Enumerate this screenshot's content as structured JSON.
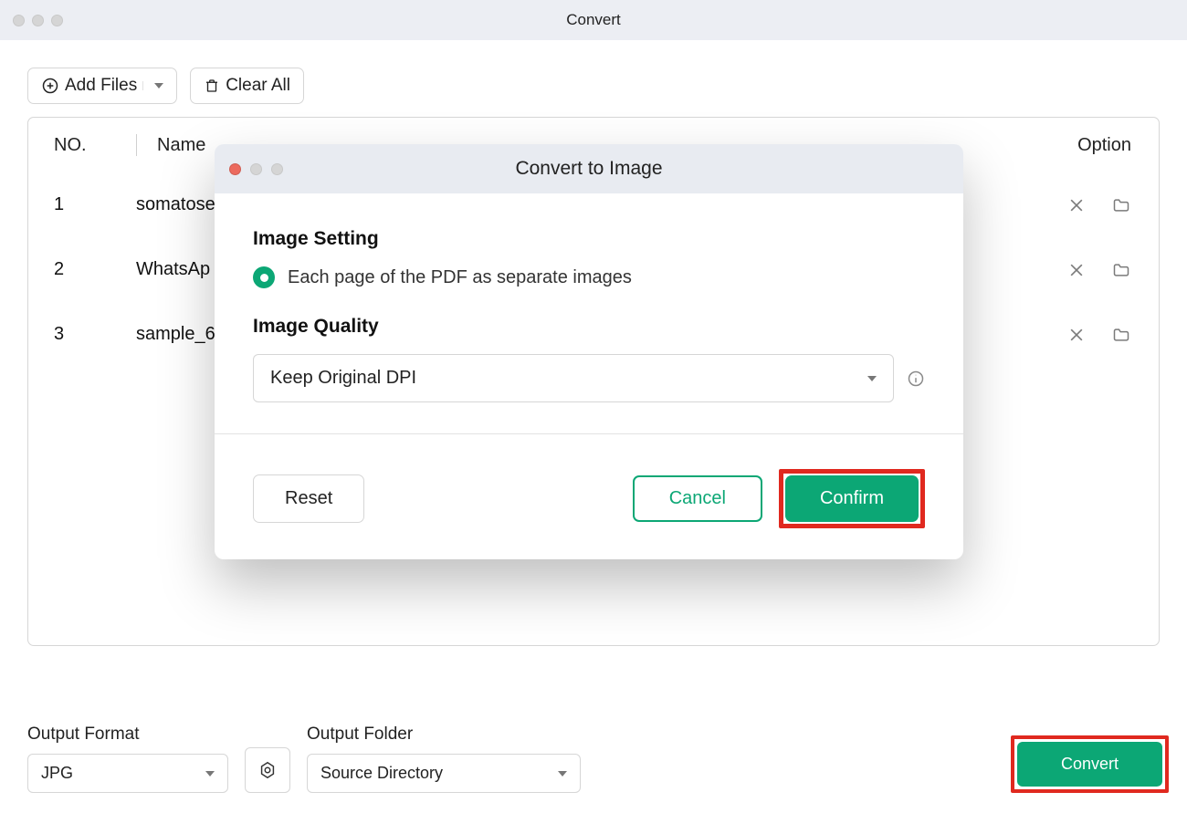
{
  "window": {
    "title": "Convert"
  },
  "toolbar": {
    "add_files": "Add Files",
    "clear_all": "Clear All"
  },
  "table": {
    "headers": {
      "no": "NO.",
      "name": "Name",
      "option": "Option"
    },
    "rows": [
      {
        "no": "1",
        "name": "somatose"
      },
      {
        "no": "2",
        "name": "WhatsAp"
      },
      {
        "no": "3",
        "name": "sample_6"
      }
    ]
  },
  "modal": {
    "title": "Convert to Image",
    "image_setting_h": "Image Setting",
    "radio_label": "Each page of the PDF as separate images",
    "image_quality_h": "Image Quality",
    "quality_value": "Keep Original DPI",
    "reset": "Reset",
    "cancel": "Cancel",
    "confirm": "Confirm"
  },
  "footer": {
    "output_format_label": "Output Format",
    "output_format_value": "JPG",
    "output_folder_label": "Output Folder",
    "output_folder_value": "Source Directory",
    "convert": "Convert"
  }
}
